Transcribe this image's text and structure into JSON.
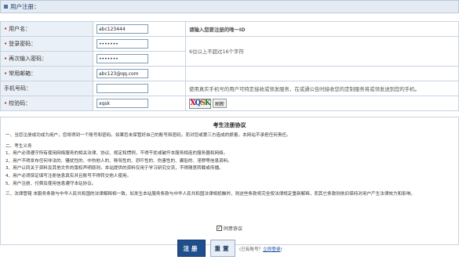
{
  "header": {
    "title": "用户注册："
  },
  "form": {
    "rows": [
      {
        "label": "用户名：",
        "required": true,
        "value": "abc123444",
        "type": "text",
        "hint": "请输入您要注册的唯一ID"
      },
      {
        "label": "登录密码：",
        "required": true,
        "value": "•••••••",
        "type": "password"
      },
      {
        "label": "再次输入密码：",
        "required": true,
        "value": "•••••••",
        "type": "password"
      },
      {
        "label": "常用邮箱：",
        "required": true,
        "value": "abc123@qq.com",
        "type": "text",
        "hint": ""
      },
      {
        "label": "手机号码：",
        "required": false,
        "value": "",
        "type": "text",
        "hint": "使用真实手机号的用户可特定接收或领发服务，在或通公告时接收您的定制服务将或领发送到您的手机。"
      },
      {
        "label": "校验码：",
        "required": true,
        "value": "xqsk",
        "type": "text"
      }
    ],
    "password_hint": "6位以上不超过16个字符",
    "captcha": {
      "chars": [
        "X",
        "Q",
        "S",
        "K"
      ],
      "refresh_label": "刷新"
    }
  },
  "agreement": {
    "title": "考生注册协议",
    "paragraphs": [
      "一、当您注册成功成为用户，您将得到一个账号和密码。如果您未保管好自己的账号和密码，而对您或第三方造成的损害，本网站不承担任何责任。",
      "",
      "二、考生义务",
      "1、用户必须遵守所有使用网络服务的相关法律、协议、规定和惯例，不得干扰或破坏本服务相连的服务器和网络。",
      "2、用户不得发布任何非法的、骚扰性的、中伤他人的、辱骂性的、恐吓性的、伤害性的、庸俗的、淫秽等信息资料。",
      "3、用户认同关于资料及其他文件的版权声明原则，本站提供的资料仅用于学习研究交流，不得随意转载或传播。",
      "4、用户必须保证填写注册信息真实并且账号不得转交他人使用。",
      "5、用户注册、付费及使用信息遵守本站协议。",
      "",
      "三、法律管辖  本服务条款与中华人民共和国的法律解释相一致，如发生本站服务条款与中华人民共和国法律相抵触时，则这些条款将完全按法律规定重新解释，而其它条款则依旧保持对用户产生法律效力和影响。"
    ],
    "agree_label": "同意协议",
    "agree_checked_glyph": "✓"
  },
  "buttons": {
    "register": "注册",
    "reset": "重置",
    "login_prompt": "(已有账号？",
    "login_link": "立即登录",
    "login_suffix": ")"
  },
  "colors": {
    "primary": "#1f4e8c",
    "required": "#d00000",
    "header_bg": "#e4ebf3",
    "label_bg": "#eaf0f7"
  }
}
